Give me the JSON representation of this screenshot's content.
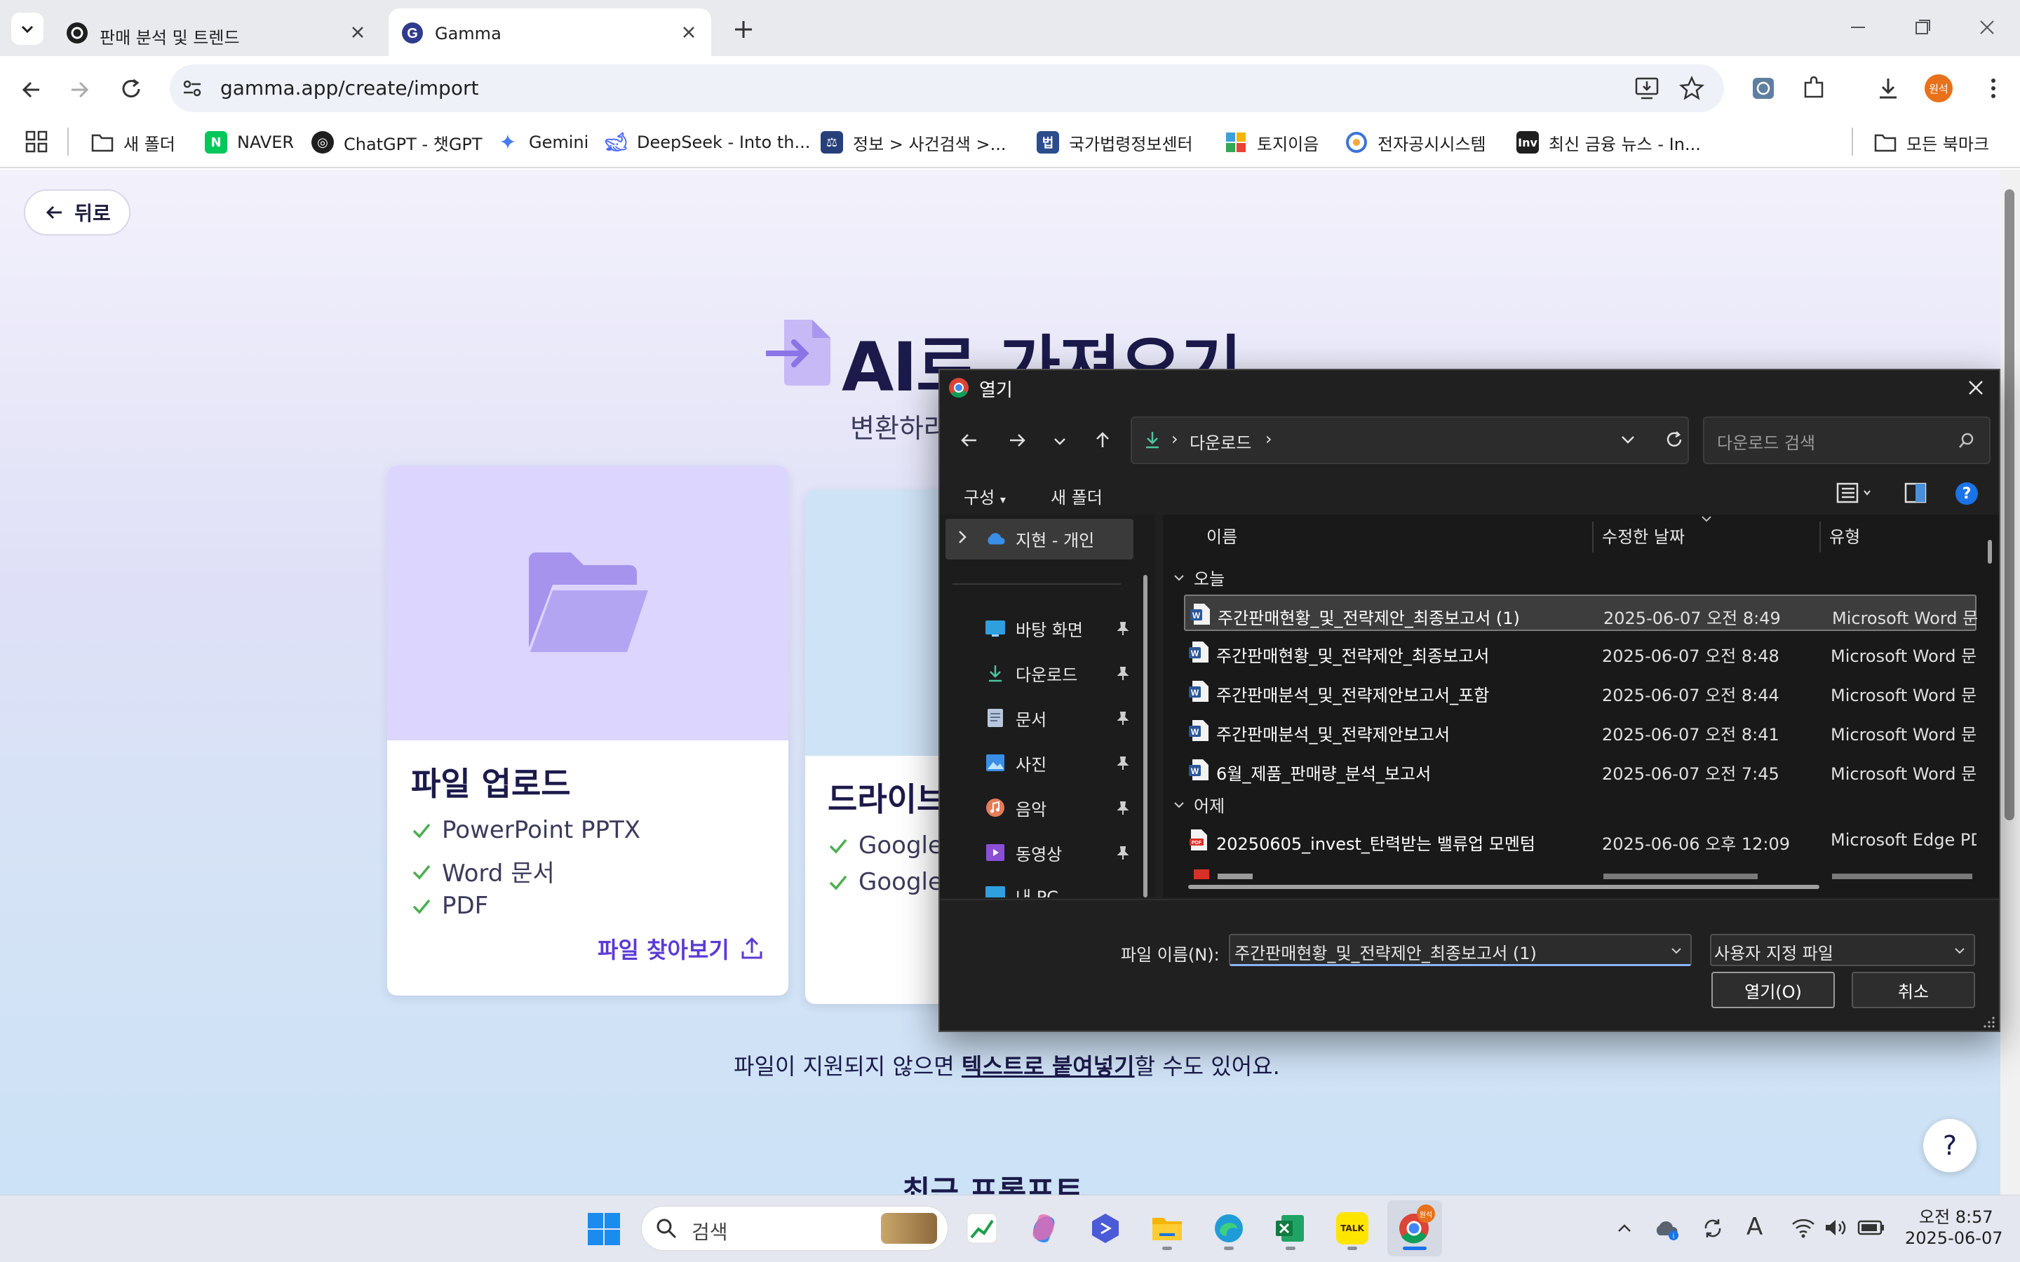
{
  "browser": {
    "tabs": [
      {
        "title": "판매 분석 및 트렌드",
        "active": false
      },
      {
        "title": "Gamma",
        "active": true
      }
    ],
    "url": "gamma.app/create/import",
    "profile_label": "원석",
    "bookmarks": [
      {
        "label": "새 폴더",
        "icon": "folder-icon"
      },
      {
        "label": "NAVER",
        "icon": "naver-icon"
      },
      {
        "label": "ChatGPT - 챗GPT",
        "icon": "chatgpt-icon"
      },
      {
        "label": "Gemini",
        "icon": "gemini-icon"
      },
      {
        "label": "DeepSeek - Into th...",
        "icon": "deepseek-icon"
      },
      {
        "label": "정보 > 사건검색 >...",
        "icon": "court-icon"
      },
      {
        "label": "국가법령정보센터",
        "icon": "law-icon"
      },
      {
        "label": "토지이음",
        "icon": "land-icon"
      },
      {
        "label": "전자공시시스템",
        "icon": "dart-icon"
      },
      {
        "label": "최신 금융 뉴스 - In...",
        "icon": "investing-icon"
      }
    ],
    "all_bookmarks": "모든 북마크"
  },
  "page": {
    "back_label": "뒤로",
    "hero_title": "AI로 가져오기",
    "hero_subtitle": "변환하라",
    "upload_card": {
      "title": "파일 업로드",
      "items": [
        "PowerPoint PPTX",
        "Word 문서",
        "PDF"
      ],
      "browse": "파일 찾아보기"
    },
    "drive_card": {
      "title": "드라이브",
      "items": [
        "Google",
        "Google"
      ]
    },
    "paste_hint_prefix": "파일이 지원되지 않으면 ",
    "paste_hint_link": "텍스트로 붙여넣기",
    "paste_hint_suffix": "할 수도 있어요.",
    "recent_title": "최근 프롬프트",
    "help": "?"
  },
  "dialog": {
    "title": "열기",
    "path_label": "다운로드",
    "search_placeholder": "다운로드 검색",
    "organize": "구성",
    "new_folder": "새 폴더",
    "nav": {
      "onedrive": "지현 - 개인",
      "items": [
        {
          "label": "바탕 화면",
          "icon": "desktop-icon"
        },
        {
          "label": "다운로드",
          "icon": "download-icon"
        },
        {
          "label": "문서",
          "icon": "document-icon"
        },
        {
          "label": "사진",
          "icon": "picture-icon"
        },
        {
          "label": "음악",
          "icon": "music-icon"
        },
        {
          "label": "동영상",
          "icon": "video-icon"
        },
        {
          "label": "내 PC",
          "icon": "pc-icon"
        }
      ]
    },
    "columns": {
      "name": "이름",
      "date": "수정한 날짜",
      "type": "유형"
    },
    "groups": {
      "today": "오늘",
      "yesterday": "어제"
    },
    "files": [
      {
        "name": "주간판매현황_및_전략제안_최종보고서 (1)",
        "date": "2025-06-07 오전 8:49",
        "type": "Microsoft Word 문서",
        "kind": "word"
      },
      {
        "name": "주간판매현황_및_전략제안_최종보고서",
        "date": "2025-06-07 오전 8:48",
        "type": "Microsoft Word 문서",
        "kind": "word"
      },
      {
        "name": "주간판매분석_및_전략제안보고서_포함",
        "date": "2025-06-07 오전 8:44",
        "type": "Microsoft Word 문서",
        "kind": "word"
      },
      {
        "name": "주간판매분석_및_전략제안보고서",
        "date": "2025-06-07 오전 8:41",
        "type": "Microsoft Word 문서",
        "kind": "word"
      },
      {
        "name": "6월_제품_판매량_분석_보고서",
        "date": "2025-06-07 오전 7:45",
        "type": "Microsoft Word 문서",
        "kind": "word"
      },
      {
        "name": "20250605_invest_탄력받는 밸류업 모멘텀",
        "date": "2025-06-06 오후 12:09",
        "type": "Microsoft Edge PDF",
        "kind": "pdf"
      }
    ],
    "filename_label": "파일 이름(N):",
    "filename_value": "주간판매현황_및_전략제안_최종보고서 (1)",
    "filetype_value": "사용자 지정 파일",
    "open_label": "열기(O)",
    "cancel_label": "취소"
  },
  "taskbar": {
    "search_placeholder": "검색",
    "time": "오전 8:57",
    "date": "2025-06-07",
    "kakao_label": "TALK"
  },
  "colors": {
    "accent_purple": "#5b3ad6",
    "navy": "#1b1a4a",
    "check_green": "#4caf50",
    "dialog_bg": "#202020"
  }
}
